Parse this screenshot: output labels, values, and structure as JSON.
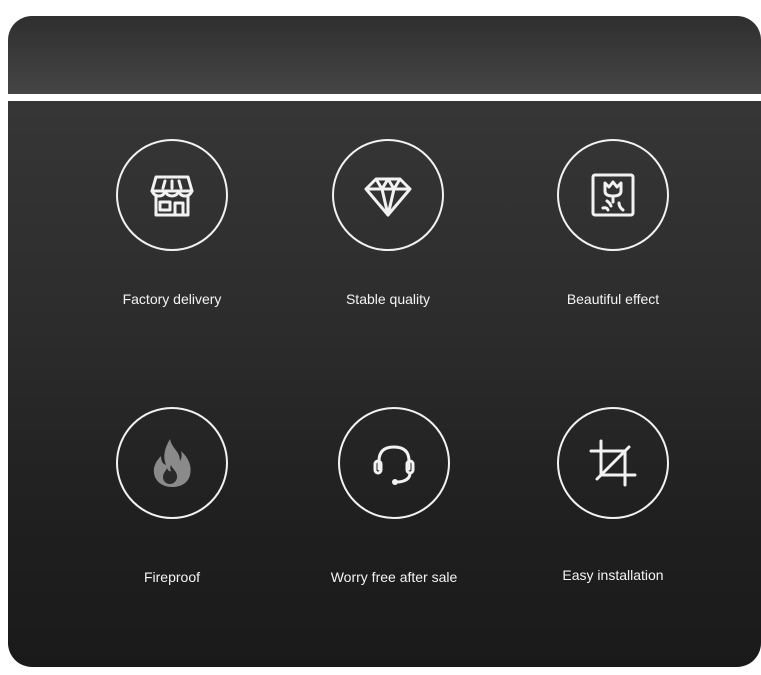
{
  "features": [
    {
      "label": "Factory delivery",
      "icon": "storefront-icon"
    },
    {
      "label": "Stable quality",
      "icon": "diamond-icon"
    },
    {
      "label": "Beautiful effect",
      "icon": "flower-picture-icon"
    },
    {
      "label": "Fireproof",
      "icon": "flame-icon"
    },
    {
      "label": "Worry free after sale",
      "icon": "headset-icon"
    },
    {
      "label": "Easy installation",
      "icon": "crop-icon"
    }
  ],
  "colors": {
    "panel_dark": "#1f1f1f",
    "panel_light": "#363636",
    "icon_stroke": "#f2f2f2",
    "flame_fill": "#8a8a8a",
    "text": "#f4f4f4"
  }
}
